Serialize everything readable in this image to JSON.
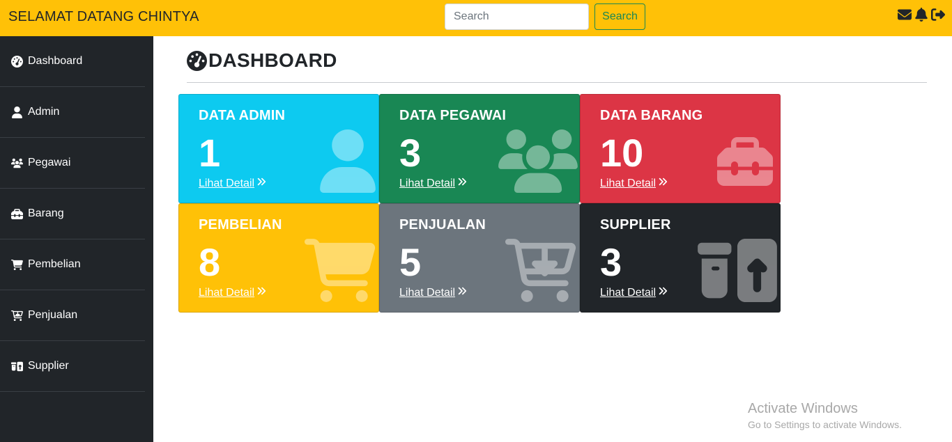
{
  "topbar": {
    "brand": "SELAMAT DATANG CHINTYA",
    "search_placeholder": "Search",
    "search_button": "Search",
    "icons": [
      "envelope-icon",
      "bell-icon",
      "sign-out-icon"
    ],
    "color": "#ffc107"
  },
  "sidebar": {
    "items": [
      {
        "label": "Dashboard",
        "icon": "tachometer-icon"
      },
      {
        "label": "Admin",
        "icon": "user-icon"
      },
      {
        "label": "Pegawai",
        "icon": "users-icon"
      },
      {
        "label": "Barang",
        "icon": "toolbox-icon"
      },
      {
        "label": "Pembelian",
        "icon": "cart-icon"
      },
      {
        "label": "Penjualan",
        "icon": "cart-arrow-down-icon"
      },
      {
        "label": "Supplier",
        "icon": "box-arrow-up-icon"
      }
    ]
  },
  "page": {
    "title": "DASHBOARD"
  },
  "cards": [
    {
      "title": "DATA ADMIN",
      "count": "1",
      "link": "Lihat Detail",
      "color": "#0dcaf0",
      "icon": "user-icon"
    },
    {
      "title": "DATA PEGAWAI",
      "count": "3",
      "link": "Lihat Detail",
      "color": "#198754",
      "icon": "users-icon"
    },
    {
      "title": "DATA BARANG",
      "count": "10",
      "link": "Lihat Detail",
      "color": "#dc3545",
      "icon": "toolbox-icon"
    },
    {
      "title": "PEMBELIAN",
      "count": "8",
      "link": "Lihat Detail",
      "color": "#ffc107",
      "icon": "cart-icon"
    },
    {
      "title": "PENJUALAN",
      "count": "5",
      "link": "Lihat Detail",
      "color": "#6c757d",
      "icon": "cart-arrow-down-icon"
    },
    {
      "title": "SUPPLIER",
      "count": "3",
      "link": "Lihat Detail",
      "color": "#212529",
      "icon": "box-arrow-up-icon"
    }
  ],
  "watermark": {
    "line1": "Activate Windows",
    "line2": "Go to Settings to activate Windows."
  }
}
